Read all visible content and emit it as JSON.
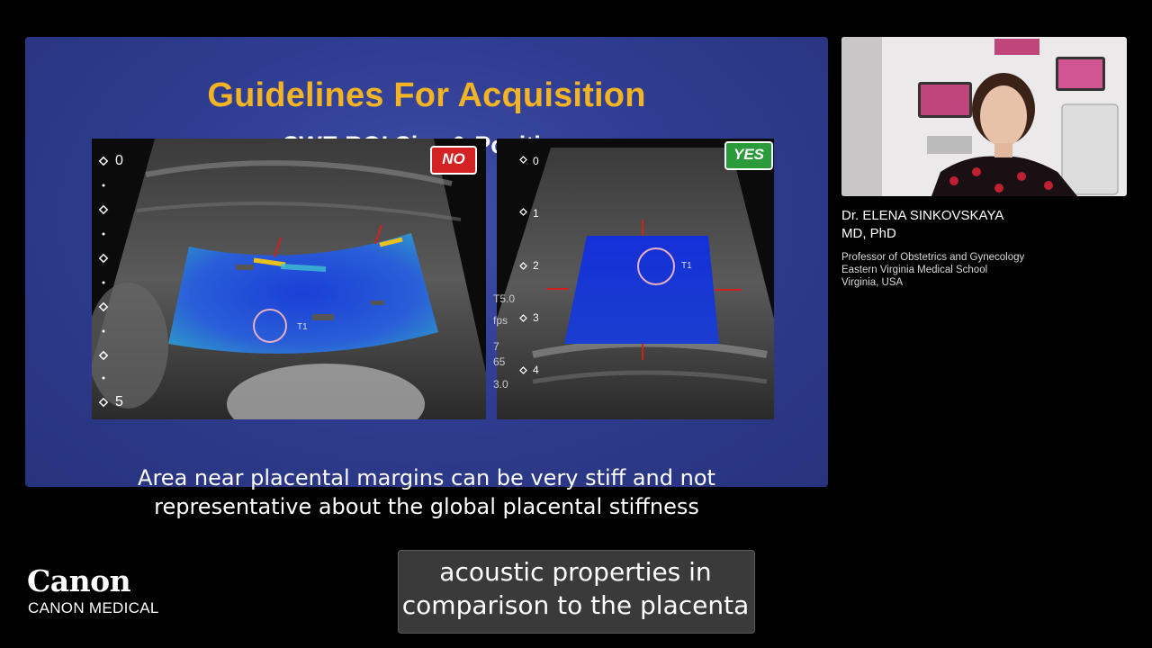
{
  "slide": {
    "title": "Guidelines For Acquisition",
    "subtitle": "SWE ROI Size & Position",
    "caption_line1": "Area near placental margins can be very stiff and not",
    "caption_line2": "representative about the global placental stiffness",
    "left_image": {
      "badge": "NO",
      "badge_color": "#d42222",
      "depth_top": "0",
      "depth_bottom": "5",
      "roi_label": "T1"
    },
    "right_image": {
      "badge": "YES",
      "badge_color": "#2a9a3a",
      "depth_marks": [
        "0",
        "1",
        "2",
        "3",
        "4"
      ],
      "roi_label": "T1",
      "side_readouts": [
        "T5.0",
        "fps",
        "7",
        "65",
        "3.0"
      ]
    }
  },
  "speaker": {
    "name": "Dr. ELENA SINKOVSKAYA",
    "degree": "MD, PhD",
    "affiliation": [
      "Professor of Obstetrics and Gynecology",
      "Eastern Virginia Medical School",
      "Virginia, USA"
    ]
  },
  "logo": {
    "brand": "Canon",
    "division": "CANON MEDICAL"
  },
  "subtitles": {
    "line1": "acoustic properties in",
    "line2": "comparison to the placenta"
  }
}
